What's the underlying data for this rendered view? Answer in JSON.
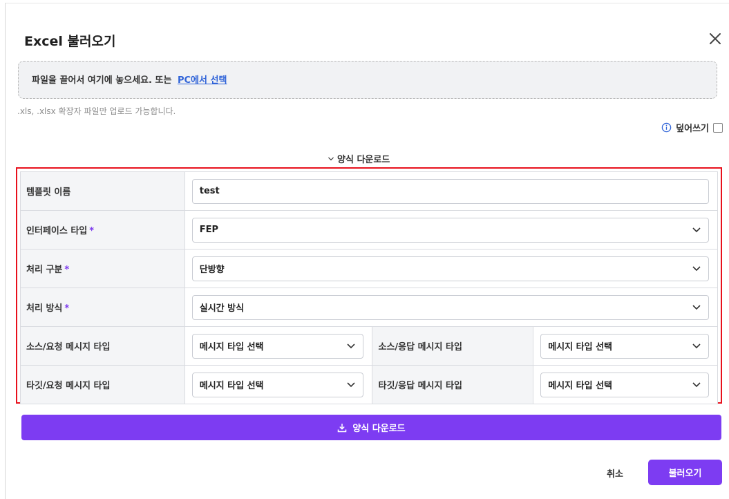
{
  "dialog": {
    "title": "Excel 불러오기",
    "close_icon": "close-icon"
  },
  "dropzone": {
    "text": "파일을 끌어서 여기에 놓으세요. 또는",
    "link": "PC에서 선택"
  },
  "hint": ".xls, .xlsx 확장자 파일만 업로드 가능합니다.",
  "overwrite": {
    "label": "덮어쓰기",
    "checked": false,
    "icon": "info-icon"
  },
  "template_toggle": {
    "label": "양식 다운로드",
    "icon": "chevron-down-icon"
  },
  "form": {
    "template_name": {
      "label": "템플릿 이름",
      "value": "test"
    },
    "interface_type": {
      "label": "인터페이스 타입",
      "required_mark": "*",
      "value": "FEP"
    },
    "process_type": {
      "label": "처리 구분",
      "required_mark": "*",
      "value": "단방향"
    },
    "process_method": {
      "label": "처리 방식",
      "required_mark": "*",
      "value": "실시간 방식"
    },
    "source_request": {
      "label": "소스/요청 메시지 타입",
      "value": "메시지 타입 선택"
    },
    "source_response": {
      "label": "소스/응답 메시지 타입",
      "value": "메시지 타입 선택"
    },
    "target_request": {
      "label": "타깃/요청 메시지 타입",
      "value": "메시지 타입 선택"
    },
    "target_response": {
      "label": "타깃/응답 메시지 타입",
      "value": "메시지 타입 선택"
    }
  },
  "buttons": {
    "download": "양식 다운로드",
    "download_icon": "download-icon",
    "cancel": "취소",
    "load": "불러오기"
  },
  "colors": {
    "accent": "#7d3cf2",
    "highlight_border": "#e8101c",
    "link": "#2f63d8",
    "required": "#7c3aed"
  }
}
